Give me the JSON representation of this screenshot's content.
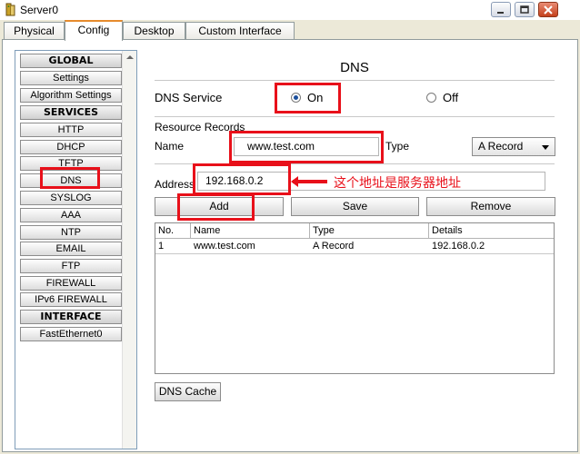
{
  "window": {
    "title": "Server0"
  },
  "tabs": [
    "Physical",
    "Config",
    "Desktop",
    "Custom Interface"
  ],
  "sidebar": {
    "items": [
      {
        "label": "GLOBAL",
        "header": true
      },
      {
        "label": "Settings"
      },
      {
        "label": "Algorithm Settings"
      },
      {
        "label": "SERVICES",
        "header": true
      },
      {
        "label": "HTTP"
      },
      {
        "label": "DHCP"
      },
      {
        "label": "TFTP"
      },
      {
        "label": "DNS",
        "selected": true
      },
      {
        "label": "SYSLOG"
      },
      {
        "label": "AAA"
      },
      {
        "label": "NTP"
      },
      {
        "label": "EMAIL"
      },
      {
        "label": "FTP"
      },
      {
        "label": "FIREWALL"
      },
      {
        "label": "IPv6 FIREWALL"
      },
      {
        "label": "INTERFACE",
        "header": true
      },
      {
        "label": "FastEthernet0"
      }
    ]
  },
  "dns": {
    "heading": "DNS",
    "service_label": "DNS Service",
    "on_label": "On",
    "off_label": "Off",
    "service_state": "On",
    "resource_records_label": "Resource Records",
    "name_label": "Name",
    "name_value": "www.test.com",
    "type_label": "Type",
    "type_value": "A Record",
    "address_label": "Address",
    "address_value": "192.168.0.2",
    "annotation": "这个地址是服务器地址",
    "add_button": "Add",
    "save_button": "Save",
    "remove_button": "Remove",
    "table": {
      "columns": [
        "No.",
        "Name",
        "Type",
        "Details"
      ],
      "rows": [
        [
          "1",
          "www.test.com",
          "A Record",
          "192.168.0.2"
        ]
      ]
    },
    "cache_button": "DNS Cache"
  },
  "colors": {
    "annotation_red": "#e8101a",
    "active_tab_accent": "#e68b2c"
  }
}
